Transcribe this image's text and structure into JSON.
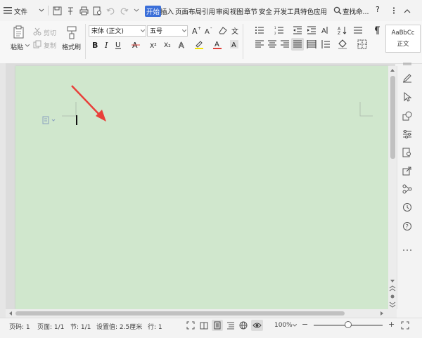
{
  "menubar": {
    "file_label": "文件",
    "tabs": [
      "开始",
      "插入",
      "页面布局",
      "引用",
      "审阅",
      "视图",
      "章节",
      "安全",
      "开发工具",
      "特色应用"
    ],
    "search_label": "查找命..."
  },
  "ribbon": {
    "paste_label": "粘贴",
    "cut_label": "剪切",
    "copy_label": "复制",
    "format_painter_label": "格式刷",
    "font_name": "宋体 (正文)",
    "font_size": "五号",
    "style_preview": "AaBbCc",
    "style_name": "正文"
  },
  "statusbar": {
    "page_num": "页码: 1",
    "pages": "页面: 1/1",
    "section": "节: 1/1",
    "setting": "设置值: 2.5厘米",
    "row": "行: 1",
    "zoom": "100%",
    "zoom_level": 0.5
  },
  "colors": {
    "accent": "#3b6fd9",
    "page_background": "#d0e7cd",
    "arrow": "#e8403a"
  }
}
